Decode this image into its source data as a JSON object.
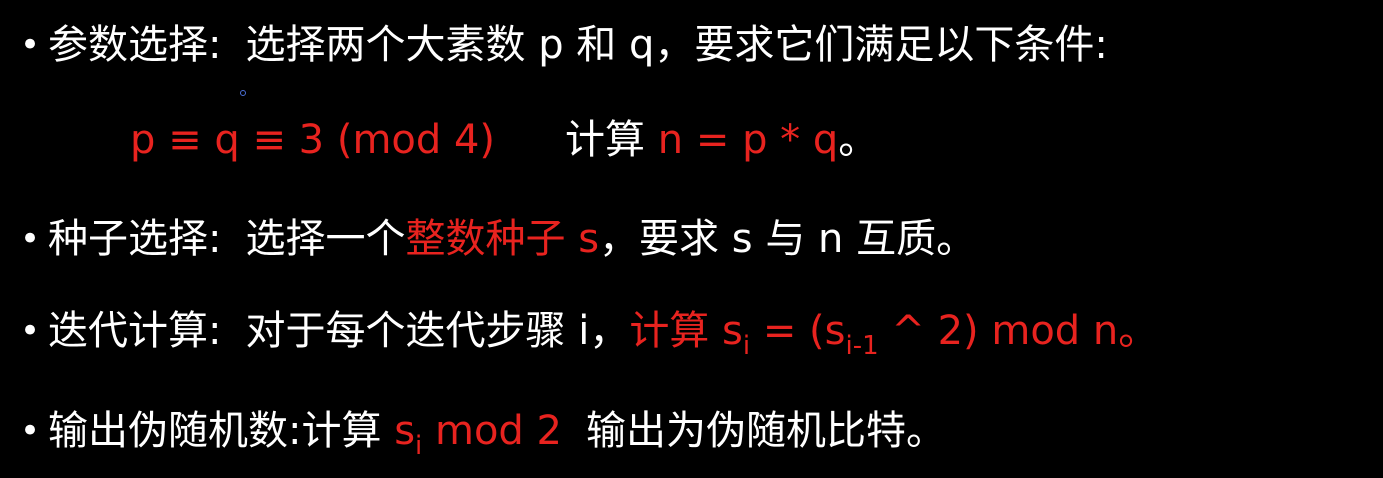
{
  "bullets": [
    {
      "label": "参数选择:",
      "text": "选择两个大素数 p 和 q，要求它们满足以下条件:"
    },
    {
      "condition": "p ≡ q ≡ 3 (mod 4)",
      "compute_label": "计算",
      "compute_expr": "n = p * q",
      "end": "。"
    },
    {
      "label": "种子选择:",
      "text_before": "选择一个",
      "highlight": "整数种子 s",
      "text_after": "，要求 s 与 n 互质。"
    },
    {
      "label": "迭代计算:",
      "text_before": "对于每个迭代步骤 i，",
      "expr_a": "计算 s",
      "sub_i": "i",
      "expr_b": " = (s",
      "sub_i1": "i-1",
      "expr_c": " ^ 2) mod n",
      "end": "。"
    },
    {
      "label": "输出伪随机数:",
      "text_before": "计算 ",
      "expr_a": "s",
      "sub_i": "i",
      "expr_b": " mod 2",
      "text_after": "输出为伪随机比特。"
    }
  ],
  "bullet_symbol": "•",
  "colors": {
    "background": "#000000",
    "text": "#ffffff",
    "highlight": "#e8231f"
  }
}
